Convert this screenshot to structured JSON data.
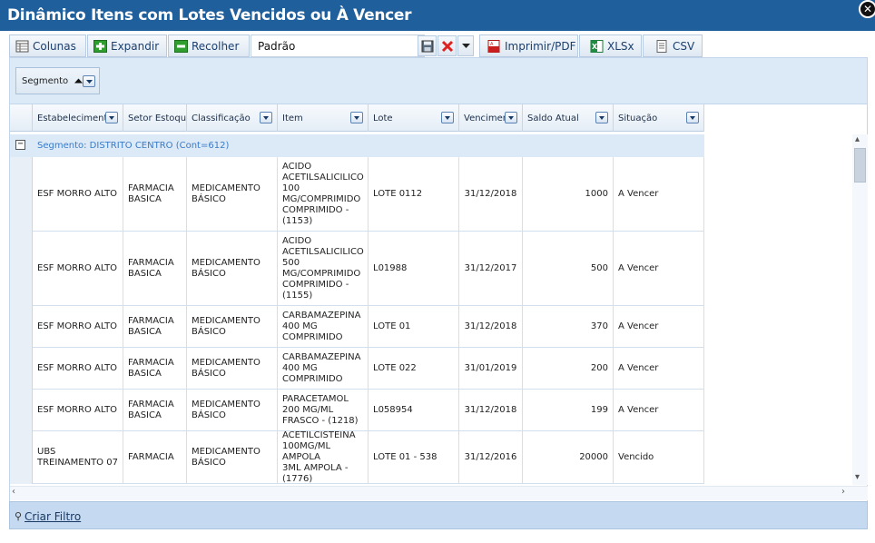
{
  "window": {
    "title": "Dinâmico Itens com Lotes Vencidos ou À Vencer"
  },
  "toolbar": {
    "columns_label": "Colunas",
    "expand_label": "Expandir",
    "collapse_label": "Recolher",
    "layout_value": "Padrão",
    "print_label": "Imprimir/PDF",
    "xlsx_label": "XLSx",
    "csv_label": "CSV"
  },
  "group_panel": {
    "chip_label": "Segmento"
  },
  "columns": [
    "Estabelecimento",
    "Setor Estoque",
    "Classificação",
    "Item",
    "Lote",
    "Vencimento",
    "Saldo Atual",
    "Situação"
  ],
  "group": {
    "label": "Segmento: DISTRITO CENTRO (Cont=612)"
  },
  "rows": [
    {
      "estabelecimento": "ESF MORRO ALTO",
      "setor": "FARMACIA\nBASICA",
      "classificacao": "MEDICAMENTO\nBÁSICO",
      "item": "ACIDO\nACETILSALICILICO\n100\nMG/COMPRIMIDO\nCOMPRIMIDO -\n(1153)",
      "lote": "LOTE 0112",
      "vencimento": "31/12/2018",
      "saldo": "1000",
      "situacao": "A Vencer"
    },
    {
      "estabelecimento": "ESF MORRO ALTO",
      "setor": "FARMACIA\nBASICA",
      "classificacao": "MEDICAMENTO\nBÁSICO",
      "item": "ACIDO\nACETILSALICILICO\n500\nMG/COMPRIMIDO\nCOMPRIMIDO -\n(1155)",
      "lote": "L01988",
      "vencimento": "31/12/2017",
      "saldo": "500",
      "situacao": "A Vencer"
    },
    {
      "estabelecimento": "ESF MORRO ALTO",
      "setor": "FARMACIA\nBASICA",
      "classificacao": "MEDICAMENTO\nBÁSICO",
      "item": "CARBAMAZEPINA\n400 MG\nCOMPRIMIDO",
      "lote": "LOTE 01",
      "vencimento": "31/12/2018",
      "saldo": "370",
      "situacao": "A Vencer"
    },
    {
      "estabelecimento": "ESF MORRO ALTO",
      "setor": "FARMACIA\nBASICA",
      "classificacao": "MEDICAMENTO\nBÁSICO",
      "item": "CARBAMAZEPINA\n400 MG\nCOMPRIMIDO",
      "lote": "LOTE 022",
      "vencimento": "31/01/2019",
      "saldo": "200",
      "situacao": "A Vencer"
    },
    {
      "estabelecimento": "ESF MORRO ALTO",
      "setor": "FARMACIA\nBASICA",
      "classificacao": "MEDICAMENTO\nBÁSICO",
      "item": "PARACETAMOL\n200 MG/ML\nFRASCO - (1218)",
      "lote": "L058954",
      "vencimento": "31/12/2018",
      "saldo": "199",
      "situacao": "A Vencer"
    },
    {
      "estabelecimento": "UBS\nTREINAMENTO 07",
      "setor": "FARMACIA",
      "classificacao": "MEDICAMENTO\nBÁSICO",
      "item": "ACETILCISTEINA\n100MG/ML AMPOLA\n3ML AMPOLA -\n(1776)",
      "lote": "LOTE 01 - 538",
      "vencimento": "31/12/2016",
      "saldo": "20000",
      "situacao": "Vencido"
    }
  ],
  "footer": {
    "create_filter_label": "Criar Filtro"
  },
  "colors": {
    "titlebar": "#1f5f9c",
    "group_panel": "#dce9f6",
    "footer": "#c5daf0",
    "group_text": "#3a7bc8"
  }
}
